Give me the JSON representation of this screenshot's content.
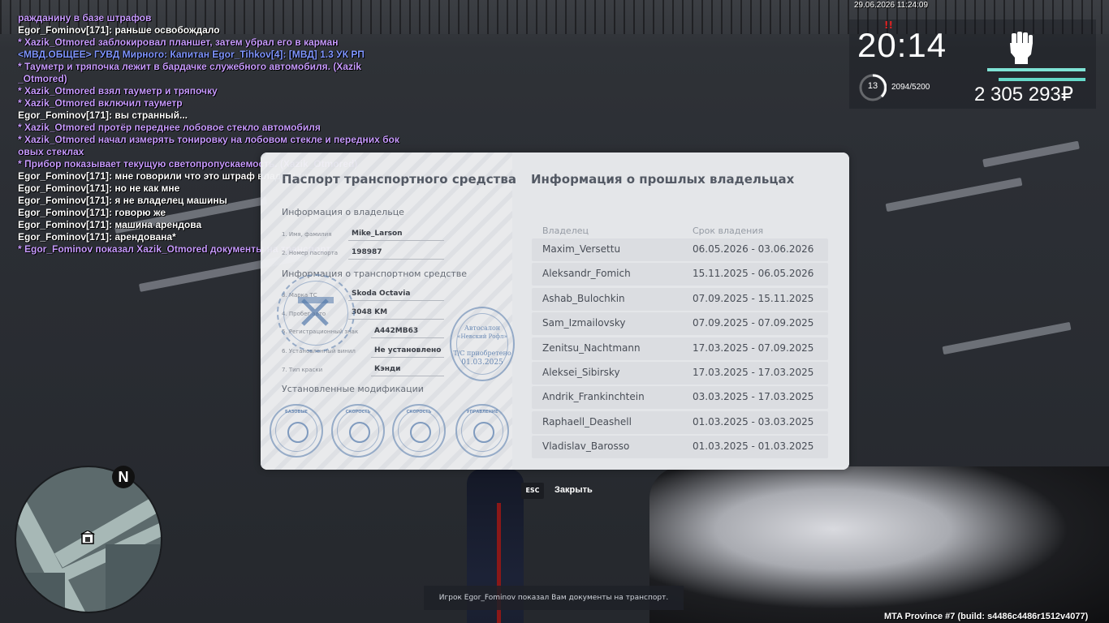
{
  "chat": [
    {
      "text": "ражданину в базе штрафов",
      "color": "purple"
    },
    {
      "text": "Egor_Fominov[171]: раньше освобождало",
      "color": "white"
    },
    {
      "text": "* Xazik_Otmored заблокировал планшет, затем убрал его в карман",
      "color": "purple"
    },
    {
      "text": "<МВД.ОБЩЕЕ> ГУВД Мирного: Капитан Egor_Tihkov[4]: [МВД] 1.3 УК РП",
      "color": "blue"
    },
    {
      "text": "* Тауметр и тряпочка лежит в бардачке служебного автомобиля. (Xazik",
      "color": "purple"
    },
    {
      "text": "_Otmored)",
      "color": "purple"
    },
    {
      "text": "* Xazik_Otmored взял тауметр и тряпочку",
      "color": "purple"
    },
    {
      "text": "* Xazik_Otmored включил тауметр",
      "color": "purple"
    },
    {
      "text": "Egor_Fominov[171]: вы странный...",
      "color": "white"
    },
    {
      "text": "* Xazik_Otmored протёр переднее лобовое стекло автомобиля",
      "color": "purple"
    },
    {
      "text": "* Xazik_Otmored начал измерять тонировку на лобовом стекле и передних бок",
      "color": "purple"
    },
    {
      "text": "овых стеклах",
      "color": "purple"
    },
    {
      "text": "* Прибор показывает текущую светопропускаемость. (Xazik_Otmored)",
      "color": "purple"
    },
    {
      "text": "Egor_Fominov[171]: мне говорили что это штраф владельцу",
      "color": "white"
    },
    {
      "text": "Egor_Fominov[171]: но не как мне",
      "color": "white"
    },
    {
      "text": "Egor_Fominov[171]: я не владелец машины",
      "color": "white"
    },
    {
      "text": "Egor_Fominov[171]: говорю же",
      "color": "white"
    },
    {
      "text": "Egor_Fominov[171]: машина арендова",
      "color": "white"
    },
    {
      "text": "Egor_Fominov[171]: арендована*",
      "color": "white"
    },
    {
      "text": "* Egor_Fominov показал Xazik_Otmored документы на транспорт",
      "color": "purple"
    }
  ],
  "hud": {
    "datetime": "29.06.2026 11:24:09",
    "time": "20:14",
    "alert_marker": "!!",
    "level": "13",
    "experience": "2094/5200",
    "money": "2 305 293₽",
    "health_fraction": 1.0,
    "armor_fraction": 1.0,
    "fist_icon": "fist-icon"
  },
  "minimap": {
    "north_label": "N"
  },
  "document": {
    "left_title": "Паспорт транспортного средства",
    "owner_section": "Информация о владельце",
    "owner_fields": [
      {
        "label": "1. Имя, фамилия",
        "value": "Mike_Larson"
      },
      {
        "label": "2. Номер паспорта",
        "value": "198987"
      }
    ],
    "vehicle_section": "Информация о транспортном средстве",
    "vehicle_fields": [
      {
        "label": "3. Марка ТС",
        "value": "Skoda Octavia"
      },
      {
        "label": "4. Пробег авто",
        "value": "3048 KM"
      },
      {
        "label": "5. Регистрационный знак",
        "value": "A442MB63"
      },
      {
        "label": "6. Установленный винил",
        "value": "Не установлено"
      },
      {
        "label": "7. Тип краски",
        "value": "Кэнди"
      }
    ],
    "mods_section": "Установленные модификации",
    "mods": [
      "БАЗОВЫЕ",
      "СКОРОСТЬ",
      "СКОРОСТЬ",
      "УПРАВЛЕНИЕ"
    ],
    "dealer_stamp": {
      "line1": "Автосалон",
      "line2": "«Невский Рофл»",
      "line3": "Т/С приобретено",
      "line4": "01.03.2025"
    },
    "right_title": "Информация о прошлых владельцах",
    "columns": {
      "owner": "Владелец",
      "period": "Срок владения"
    },
    "owners": [
      {
        "name": "Maxim_Versettu",
        "period": "06.05.2026 - 03.06.2026"
      },
      {
        "name": "Aleksandr_Fomich",
        "period": "15.11.2025 - 06.05.2026"
      },
      {
        "name": "Ashab_Bulochkin",
        "period": "07.09.2025 - 15.11.2025"
      },
      {
        "name": "Sam_Izmailovsky",
        "period": "07.09.2025 - 07.09.2025"
      },
      {
        "name": "Zenitsu_Nachtmann",
        "period": "17.03.2025 - 07.09.2025"
      },
      {
        "name": "Aleksei_Sibirsky",
        "period": "17.03.2025 - 17.03.2025"
      },
      {
        "name": "Andrik_Frankinchtein",
        "period": "03.03.2025 - 17.03.2025"
      },
      {
        "name": "Raphaell_Deashell",
        "period": "01.03.2025 - 03.03.2025"
      },
      {
        "name": "Vladislav_Barosso",
        "period": "01.03.2025 - 01.03.2025"
      }
    ]
  },
  "close": {
    "key": "ESC",
    "label": "Закрыть"
  },
  "notice": "Игрок Egor_Fominov показал Вам документы на транспорт.",
  "build": "MTA Province #7 (build: s4486c4486r1512v4077)"
}
